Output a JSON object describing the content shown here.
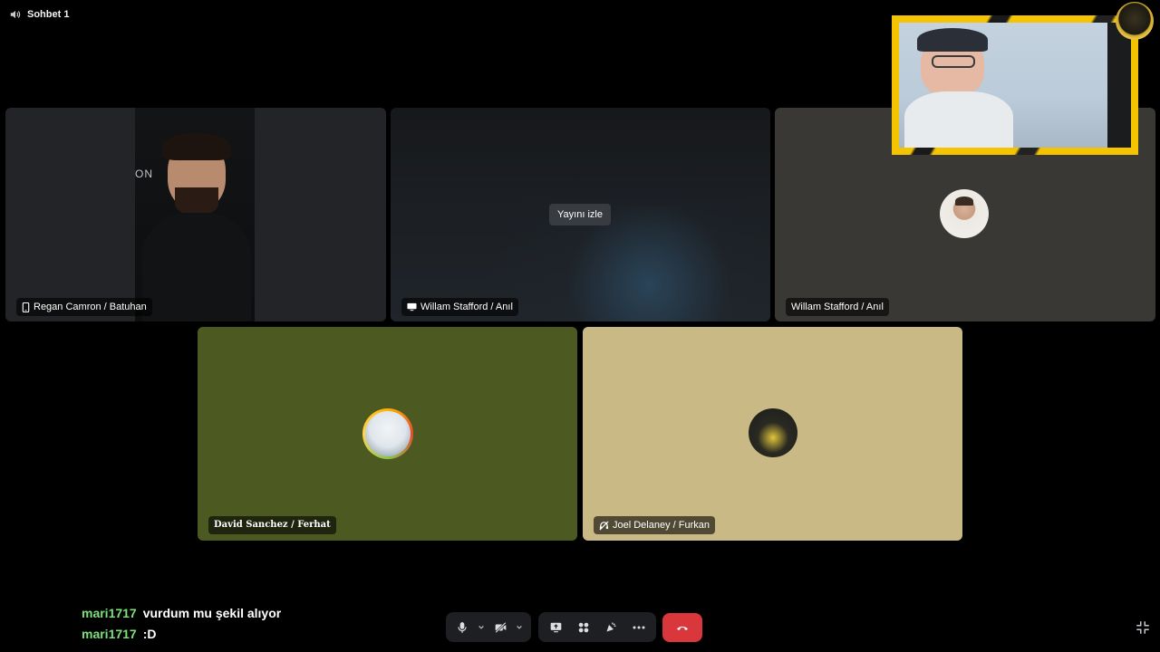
{
  "channel": {
    "icon": "speaker-icon",
    "name": "Sohbet 1"
  },
  "tiles": [
    {
      "label": "Regan Camron / Batuhan",
      "icon": "mobile-phone-icon"
    },
    {
      "label": "Willam Stafford / Anıl",
      "icon": "screen-share-icon",
      "watch_label": "Yayını izle"
    },
    {
      "label": "Willam Stafford / Anıl"
    },
    {
      "label": "David Sanchez / Ferhat"
    },
    {
      "label": "Joel Delaney / Furkan",
      "icon": "deafened-icon"
    }
  ],
  "colors": {
    "tile_dark": "#2b2d31",
    "tile_olive": "#4c5a22",
    "tile_beige": "#c8b985",
    "hangup": "#da373c",
    "chat_user": "#7ee07a"
  },
  "chat": [
    {
      "user": "mari1717",
      "text": "vurdum mu şekil alıyor"
    },
    {
      "user": "mari1717",
      "text": ":D"
    }
  ],
  "controls": {
    "buttons": [
      "microphone-icon",
      "camera-off-icon",
      "screen-share-icon",
      "activities-icon",
      "soundboard-icon",
      "more-icon",
      "hangup-icon"
    ],
    "minimize": "minimize-icon"
  }
}
